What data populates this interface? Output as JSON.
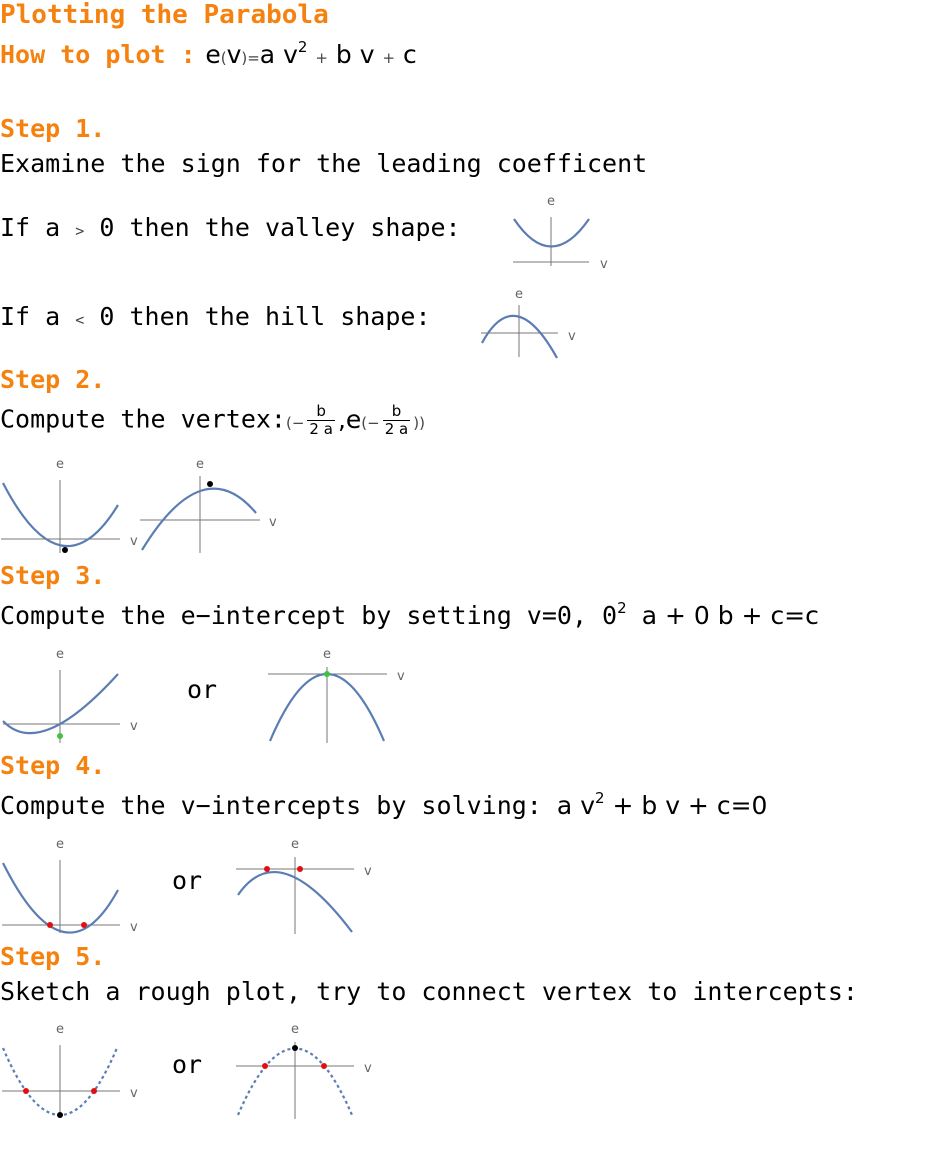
{
  "title": "Plotting the Parabola",
  "how_to_plot_label": "How to plot :",
  "equation": {
    "lhs": "e",
    "arg": "v",
    "rhs_a": "a",
    "rhs_v": "v",
    "power": "2",
    "rhs_b": "b",
    "rhs_c": "c"
  },
  "steps": [
    {
      "heading": "Step 1.",
      "text": "Examine the sign for the leading coefficent",
      "case_pos_prefix": "If a",
      "case_pos_op": ">",
      "case_pos_suffix": "0 then the valley shape:",
      "case_neg_prefix": "If a",
      "case_neg_op": "<",
      "case_neg_suffix": "0 then the hill shape:"
    },
    {
      "heading": "Step 2.",
      "text": "Compute the vertex:",
      "frac_num": "b",
      "frac_den": "2 a",
      "func": "e"
    },
    {
      "heading": "Step 3.",
      "text": "Compute the e−intercept by setting v=0, 0",
      "power": "2",
      "tail": "a + 0 b + c=c",
      "or": "or"
    },
    {
      "heading": "Step 4.",
      "text": "Compute the v−intercepts by solving:",
      "eq_a": "a v",
      "power": "2",
      "eq_tail": "+ b v + c=0",
      "or": "or"
    },
    {
      "heading": "Step 5.",
      "text": "Sketch a rough plot, try to connect vertex to intercepts:",
      "or": "or"
    }
  ],
  "axes": {
    "x": "v",
    "y": "e"
  },
  "colors": {
    "heading": "#f5820f",
    "curve": "#5b7db3",
    "vertex_point": "#000000",
    "e_intercept_point": "#3ec43e",
    "v_intercept_point": "#e01010"
  }
}
